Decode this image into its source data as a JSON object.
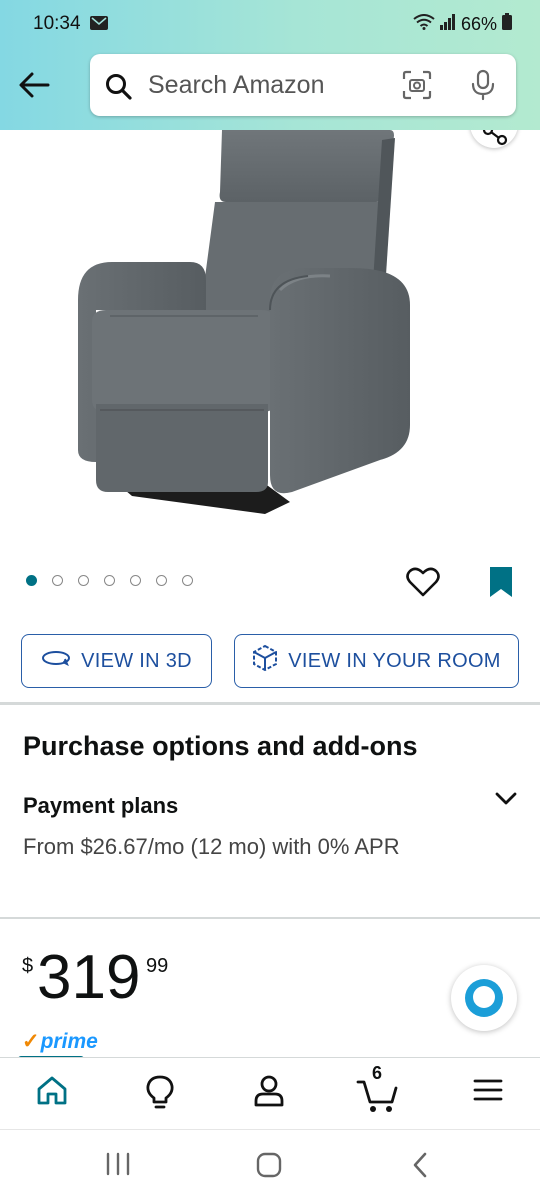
{
  "status_bar": {
    "time": "10:34",
    "battery": "66%"
  },
  "search": {
    "placeholder": "Search Amazon"
  },
  "carousel": {
    "image_count": 7,
    "active_index": 0
  },
  "buttons": {
    "view_3d": "VIEW IN 3D",
    "view_room": "VIEW IN YOUR ROOM"
  },
  "purchase": {
    "title": "Purchase options and add-ons",
    "payment_title": "Payment plans",
    "payment_desc": "From $26.67/mo (12 mo) with 0% APR"
  },
  "price": {
    "currency": "$",
    "whole": "319",
    "fraction": "99"
  },
  "prime": {
    "check": "✓",
    "label": "prime"
  },
  "bottom_nav": {
    "cart_count": "6"
  },
  "colors": {
    "accent": "#007185",
    "button_border": "#2a5ea8",
    "header_start": "#84d8e3",
    "header_end": "#b3ead0"
  }
}
